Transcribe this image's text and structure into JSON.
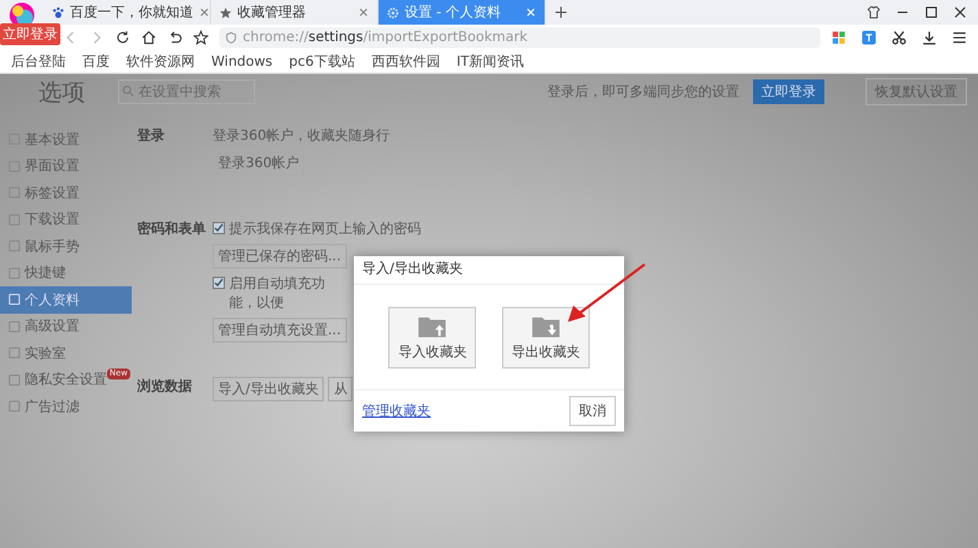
{
  "browser": {
    "login_badge": "立即登录",
    "tabs": [
      {
        "title": "百度一下，你就知道",
        "selected": false
      },
      {
        "title": "收藏管理器",
        "selected": false
      },
      {
        "title": "设置 - 个人资料",
        "selected": true
      }
    ],
    "address": "chrome://**settings**/importExportBookmark",
    "bookmarks": [
      "后台登陆",
      "百度",
      "软件资源网",
      "Windows",
      "pc6下载站",
      "西西软件园",
      "IT新闻资讯"
    ]
  },
  "settings": {
    "title": "选项",
    "search": {
      "placeholder": "在设置中搜索"
    },
    "sync_hint": "登录后，即可多端同步您的设置",
    "login_button": "立即登录",
    "reset_button": "恢复默认设置",
    "sidebar": [
      {
        "label": "基本设置",
        "selected": false
      },
      {
        "label": "界面设置",
        "selected": false
      },
      {
        "label": "标签设置",
        "selected": false
      },
      {
        "label": "下载设置",
        "selected": false
      },
      {
        "label": "鼠标手势",
        "selected": false
      },
      {
        "label": "快捷键",
        "selected": false
      },
      {
        "label": "个人资料",
        "selected": true
      },
      {
        "label": "高级设置",
        "selected": false
      },
      {
        "label": "实验室",
        "selected": false
      },
      {
        "label": "隐私安全设置",
        "selected": false,
        "badge": "New"
      },
      {
        "label": "广告过滤",
        "selected": false
      }
    ],
    "sections": [
      {
        "heading": "登录",
        "items": [
          {
            "kind": "text",
            "text": "登录360帐户，收藏夹随身行"
          },
          {
            "kind": "button",
            "text": "登录360帐户"
          }
        ]
      },
      {
        "heading": "密码和表单",
        "items": [
          {
            "kind": "checkbox",
            "text": "提示我保存在网页上输入的密码",
            "checked": true
          },
          {
            "kind": "button",
            "text": "管理已保存的密码..."
          },
          {
            "kind": "checkbox",
            "text": "启用自动填充功能，以便",
            "checked": true
          },
          {
            "kind": "button",
            "text": "管理自动填充设置..."
          }
        ]
      },
      {
        "heading": "浏览数据",
        "items": [
          {
            "kind": "buttons",
            "texts": [
              "导入/导出收藏夹",
              "从"
            ]
          }
        ]
      }
    ]
  },
  "dialog": {
    "title": "导入/导出收藏夹",
    "tiles": [
      {
        "label": "导入收藏夹",
        "kind": "import"
      },
      {
        "label": "导出收藏夹",
        "kind": "export"
      }
    ],
    "link": "管理收藏夹",
    "cancel": "取消"
  }
}
